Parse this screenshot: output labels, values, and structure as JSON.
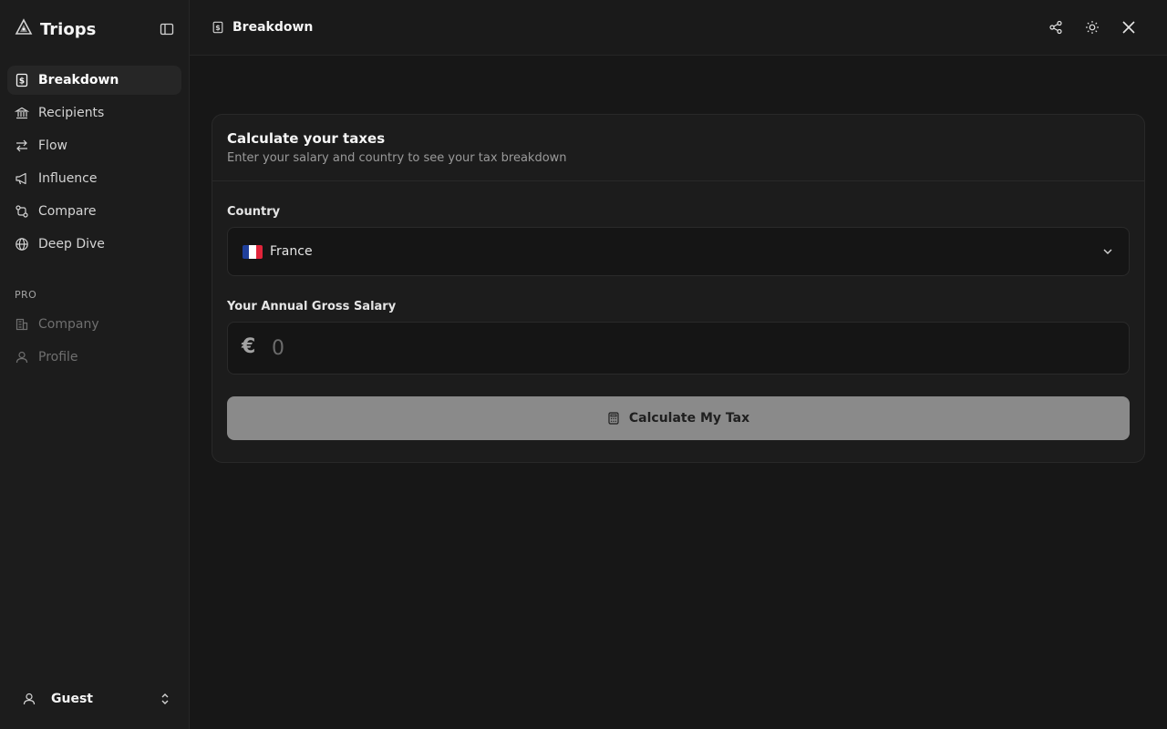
{
  "app": {
    "brand": "Triops",
    "accent_text": "#f5f5f5",
    "background": "#171717"
  },
  "sidebar": {
    "items": [
      {
        "label": "Breakdown",
        "icon": "dollar-receipt-icon",
        "active": true
      },
      {
        "label": "Recipients",
        "icon": "bank-icon"
      },
      {
        "label": "Flow",
        "icon": "arrows-left-right-icon"
      },
      {
        "label": "Influence",
        "icon": "megaphone-icon"
      },
      {
        "label": "Compare",
        "icon": "git-compare-icon"
      },
      {
        "label": "Deep Dive",
        "icon": "globe-icon"
      }
    ],
    "pro_section_label": "PRO",
    "pro_items": [
      {
        "label": "Company",
        "icon": "building-icon",
        "disabled": true
      },
      {
        "label": "Profile",
        "icon": "user-icon",
        "disabled": true
      }
    ],
    "user": {
      "name": "Guest",
      "icon": "user-icon"
    }
  },
  "topbar": {
    "breadcrumb": "Breakdown",
    "actions": [
      "share-icon",
      "sun-icon",
      "x-logo-icon"
    ]
  },
  "card": {
    "title": "Calculate your taxes",
    "subtitle": "Enter your salary and country to see your tax breakdown",
    "country_label": "Country",
    "country_value": "France",
    "flag_colors": [
      "#1f3f9b",
      "#ffffff",
      "#e0243a"
    ],
    "salary_label": "Your Annual Gross Salary",
    "currency_symbol": "€",
    "salary_placeholder": "0",
    "button_label": "Calculate My Tax",
    "button_icon": "calculator-icon"
  }
}
